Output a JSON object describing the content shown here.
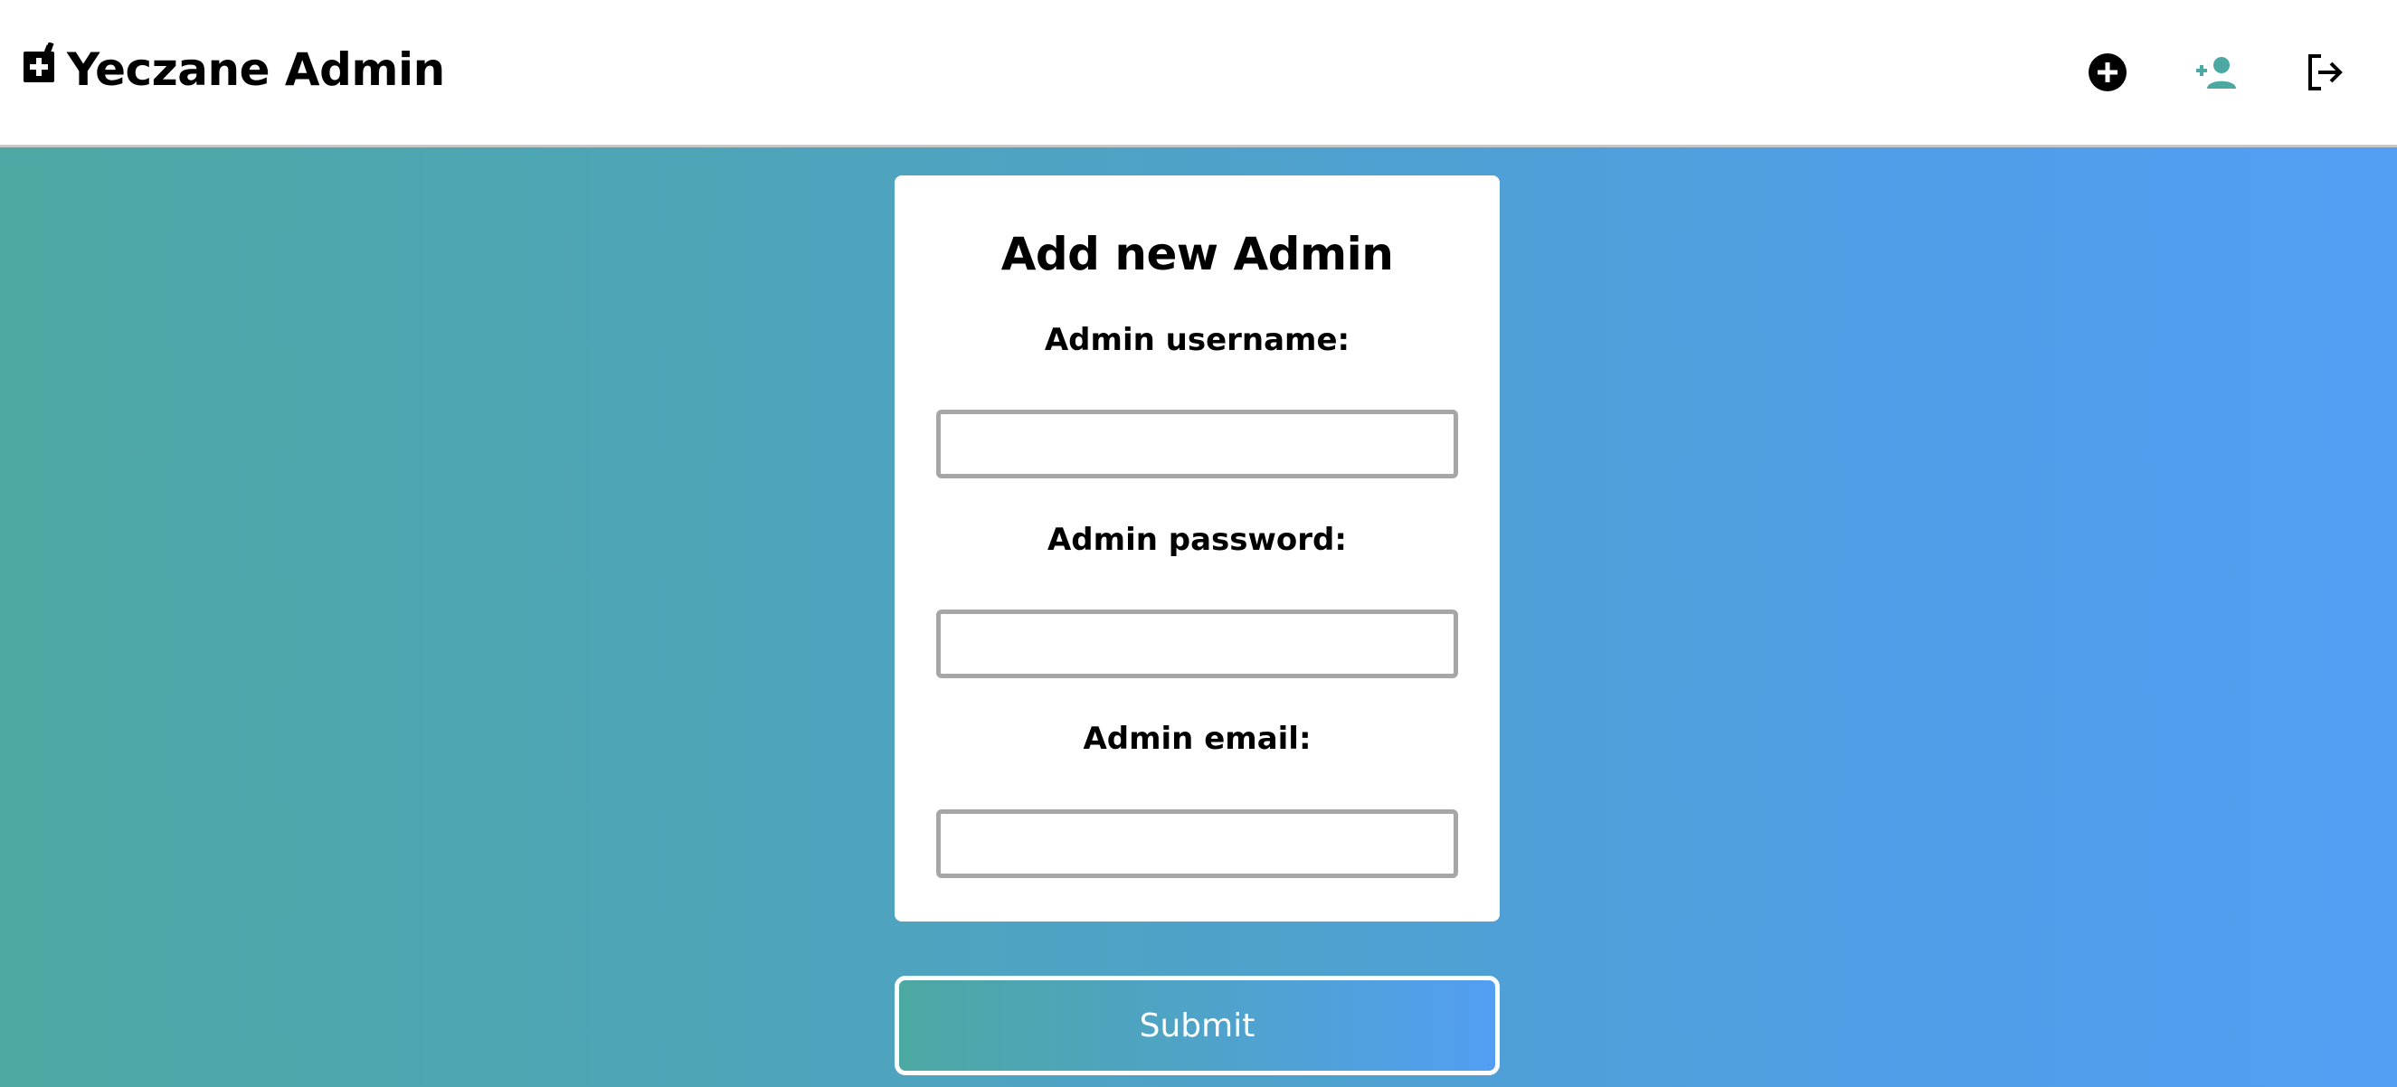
{
  "header": {
    "brand_icon": "pharmacy-icon",
    "title": "Yeczane Admin",
    "actions": [
      {
        "icon": "add-circle-icon",
        "color": "#000000"
      },
      {
        "icon": "add-user-icon",
        "color": "#4ca8a2"
      },
      {
        "icon": "logout-icon",
        "color": "#000000"
      }
    ]
  },
  "form": {
    "title": "Add new Admin",
    "username_label": "Admin username:",
    "username_value": "",
    "password_label": "Admin password:",
    "password_value": "",
    "email_label": "Admin email:",
    "email_value": "",
    "submit_label": "Submit"
  },
  "colors": {
    "gradient_start": "#4ca8a2",
    "gradient_end": "#529ef3",
    "active_icon": "#4ca8a2"
  }
}
